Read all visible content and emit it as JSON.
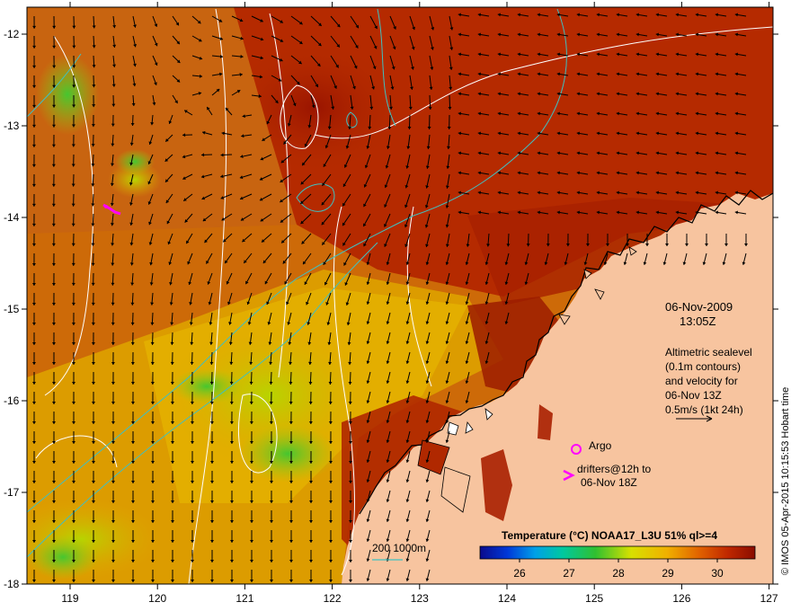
{
  "map": {
    "date": "06-Nov-2009",
    "time": "13:05Z",
    "altimetry": {
      "line1": "Altimetric sealevel",
      "line2": "(0.1m contours)",
      "line3": "and velocity for",
      "line4": "06-Nov 13Z",
      "speed": "0.5m/s (1kt 24h)"
    },
    "argo_label": "Argo",
    "drifters_line1": "drifters@12h to",
    "drifters_line2": "06-Nov 18Z",
    "bathy_label": "200  1000m",
    "colorbar_title": "Temperature (°C) NOAA17_L3U 51% ql>=4",
    "colorbar_ticks": [
      "26",
      "27",
      "28",
      "29",
      "30"
    ],
    "credit": "© IMOS 05-Apr-2015 10:15:53 Hobart time",
    "x_ticks": [
      "119",
      "120",
      "121",
      "122",
      "123",
      "124",
      "125",
      "126",
      "127"
    ],
    "y_ticks": [
      "-12",
      "-13",
      "-14",
      "-15",
      "-16",
      "-17",
      "-18"
    ],
    "colors": {
      "land": "#f7c49f",
      "sst_hot": "#a81d00",
      "sst_warm": "#c95a00",
      "sst_mid": "#e3a000",
      "sst_cool": "#d8d800",
      "sst_cold": "#3cbf2a",
      "isobath": "#40c0c0",
      "contour": "#ffffff",
      "marker": "#ff00ff"
    }
  }
}
